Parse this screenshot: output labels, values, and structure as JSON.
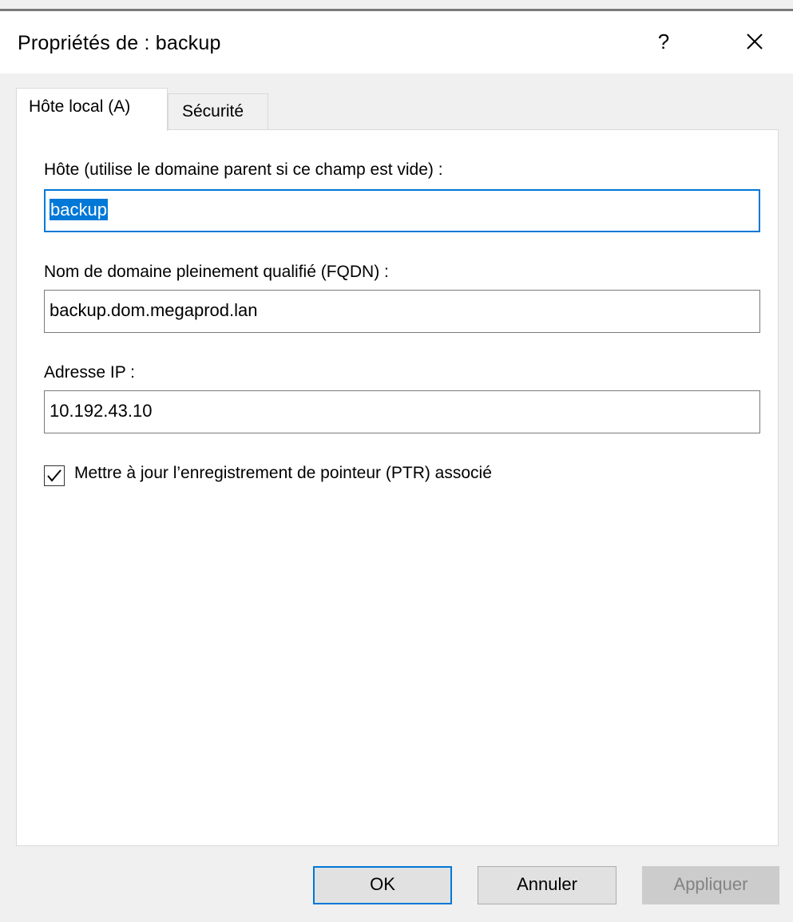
{
  "window": {
    "title": "Propriétés de : backup",
    "help_label": "?"
  },
  "tabs": [
    {
      "label": "Hôte local (A)",
      "active": true
    },
    {
      "label": "Sécurité",
      "active": false
    }
  ],
  "form": {
    "host_label": "Hôte (utilise le domaine parent si ce champ est vide) :",
    "host_value": "backup",
    "fqdn_label": "Nom de domaine pleinement qualifié (FQDN) :",
    "fqdn_value": "backup.dom.megaprod.lan",
    "ip_label": "Adresse IP :",
    "ip_value": "10.192.43.10",
    "ptr_checkbox_label": "Mettre à jour l’enregistrement de pointeur (PTR) associé",
    "ptr_checked": true
  },
  "buttons": {
    "ok": "OK",
    "cancel": "Annuler",
    "apply": "Appliquer"
  },
  "colors": {
    "accent": "#0078d7",
    "disabled_text": "#838383"
  },
  "icons": {
    "close": "close-icon",
    "check": "checkmark-icon"
  }
}
